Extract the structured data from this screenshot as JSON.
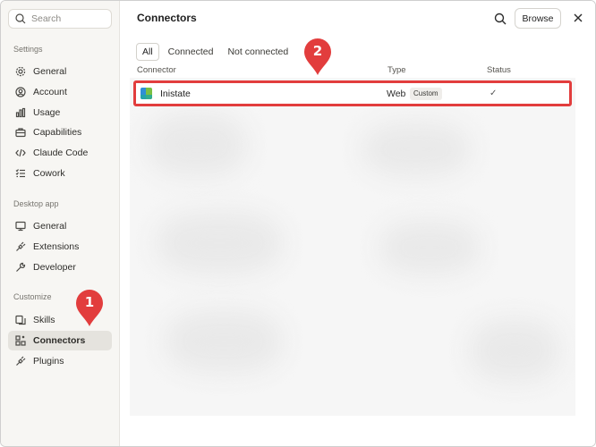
{
  "sidebar": {
    "search_placeholder": "Search",
    "sections": {
      "settings": "Settings",
      "desktop_app": "Desktop app",
      "customize": "Customize"
    },
    "items": [
      {
        "label": "General",
        "icon": "gear-icon"
      },
      {
        "label": "Account",
        "icon": "user-circle-icon"
      },
      {
        "label": "Usage",
        "icon": "bar-chart-icon"
      },
      {
        "label": "Capabilities",
        "icon": "briefcase-icon"
      },
      {
        "label": "Claude Code",
        "icon": "code-icon"
      },
      {
        "label": "Cowork",
        "icon": "checklist-icon"
      },
      {
        "label": "General",
        "icon": "monitor-icon"
      },
      {
        "label": "Extensions",
        "icon": "plug-icon"
      },
      {
        "label": "Developer",
        "icon": "wrench-icon"
      },
      {
        "label": "Skills",
        "icon": "skills-icon"
      },
      {
        "label": "Connectors",
        "icon": "connectors-icon",
        "active": true
      },
      {
        "label": "Plugins",
        "icon": "plug-icon"
      }
    ]
  },
  "main": {
    "title": "Connectors",
    "browse_label": "Browse",
    "tabs": [
      {
        "label": "All",
        "active": true
      },
      {
        "label": "Connected"
      },
      {
        "label": "Not connected"
      }
    ],
    "columns": {
      "connector": "Connector",
      "type": "Type",
      "status": "Status"
    },
    "rows": [
      {
        "name": "Inistate",
        "type": "Web",
        "badge": "Custom",
        "status": "✓"
      }
    ]
  },
  "callouts": [
    "1",
    "2"
  ],
  "colors": {
    "callout_red": "#e23d3d",
    "sidebar_bg": "#f7f6f3",
    "active_item_bg": "#e5e3de"
  }
}
